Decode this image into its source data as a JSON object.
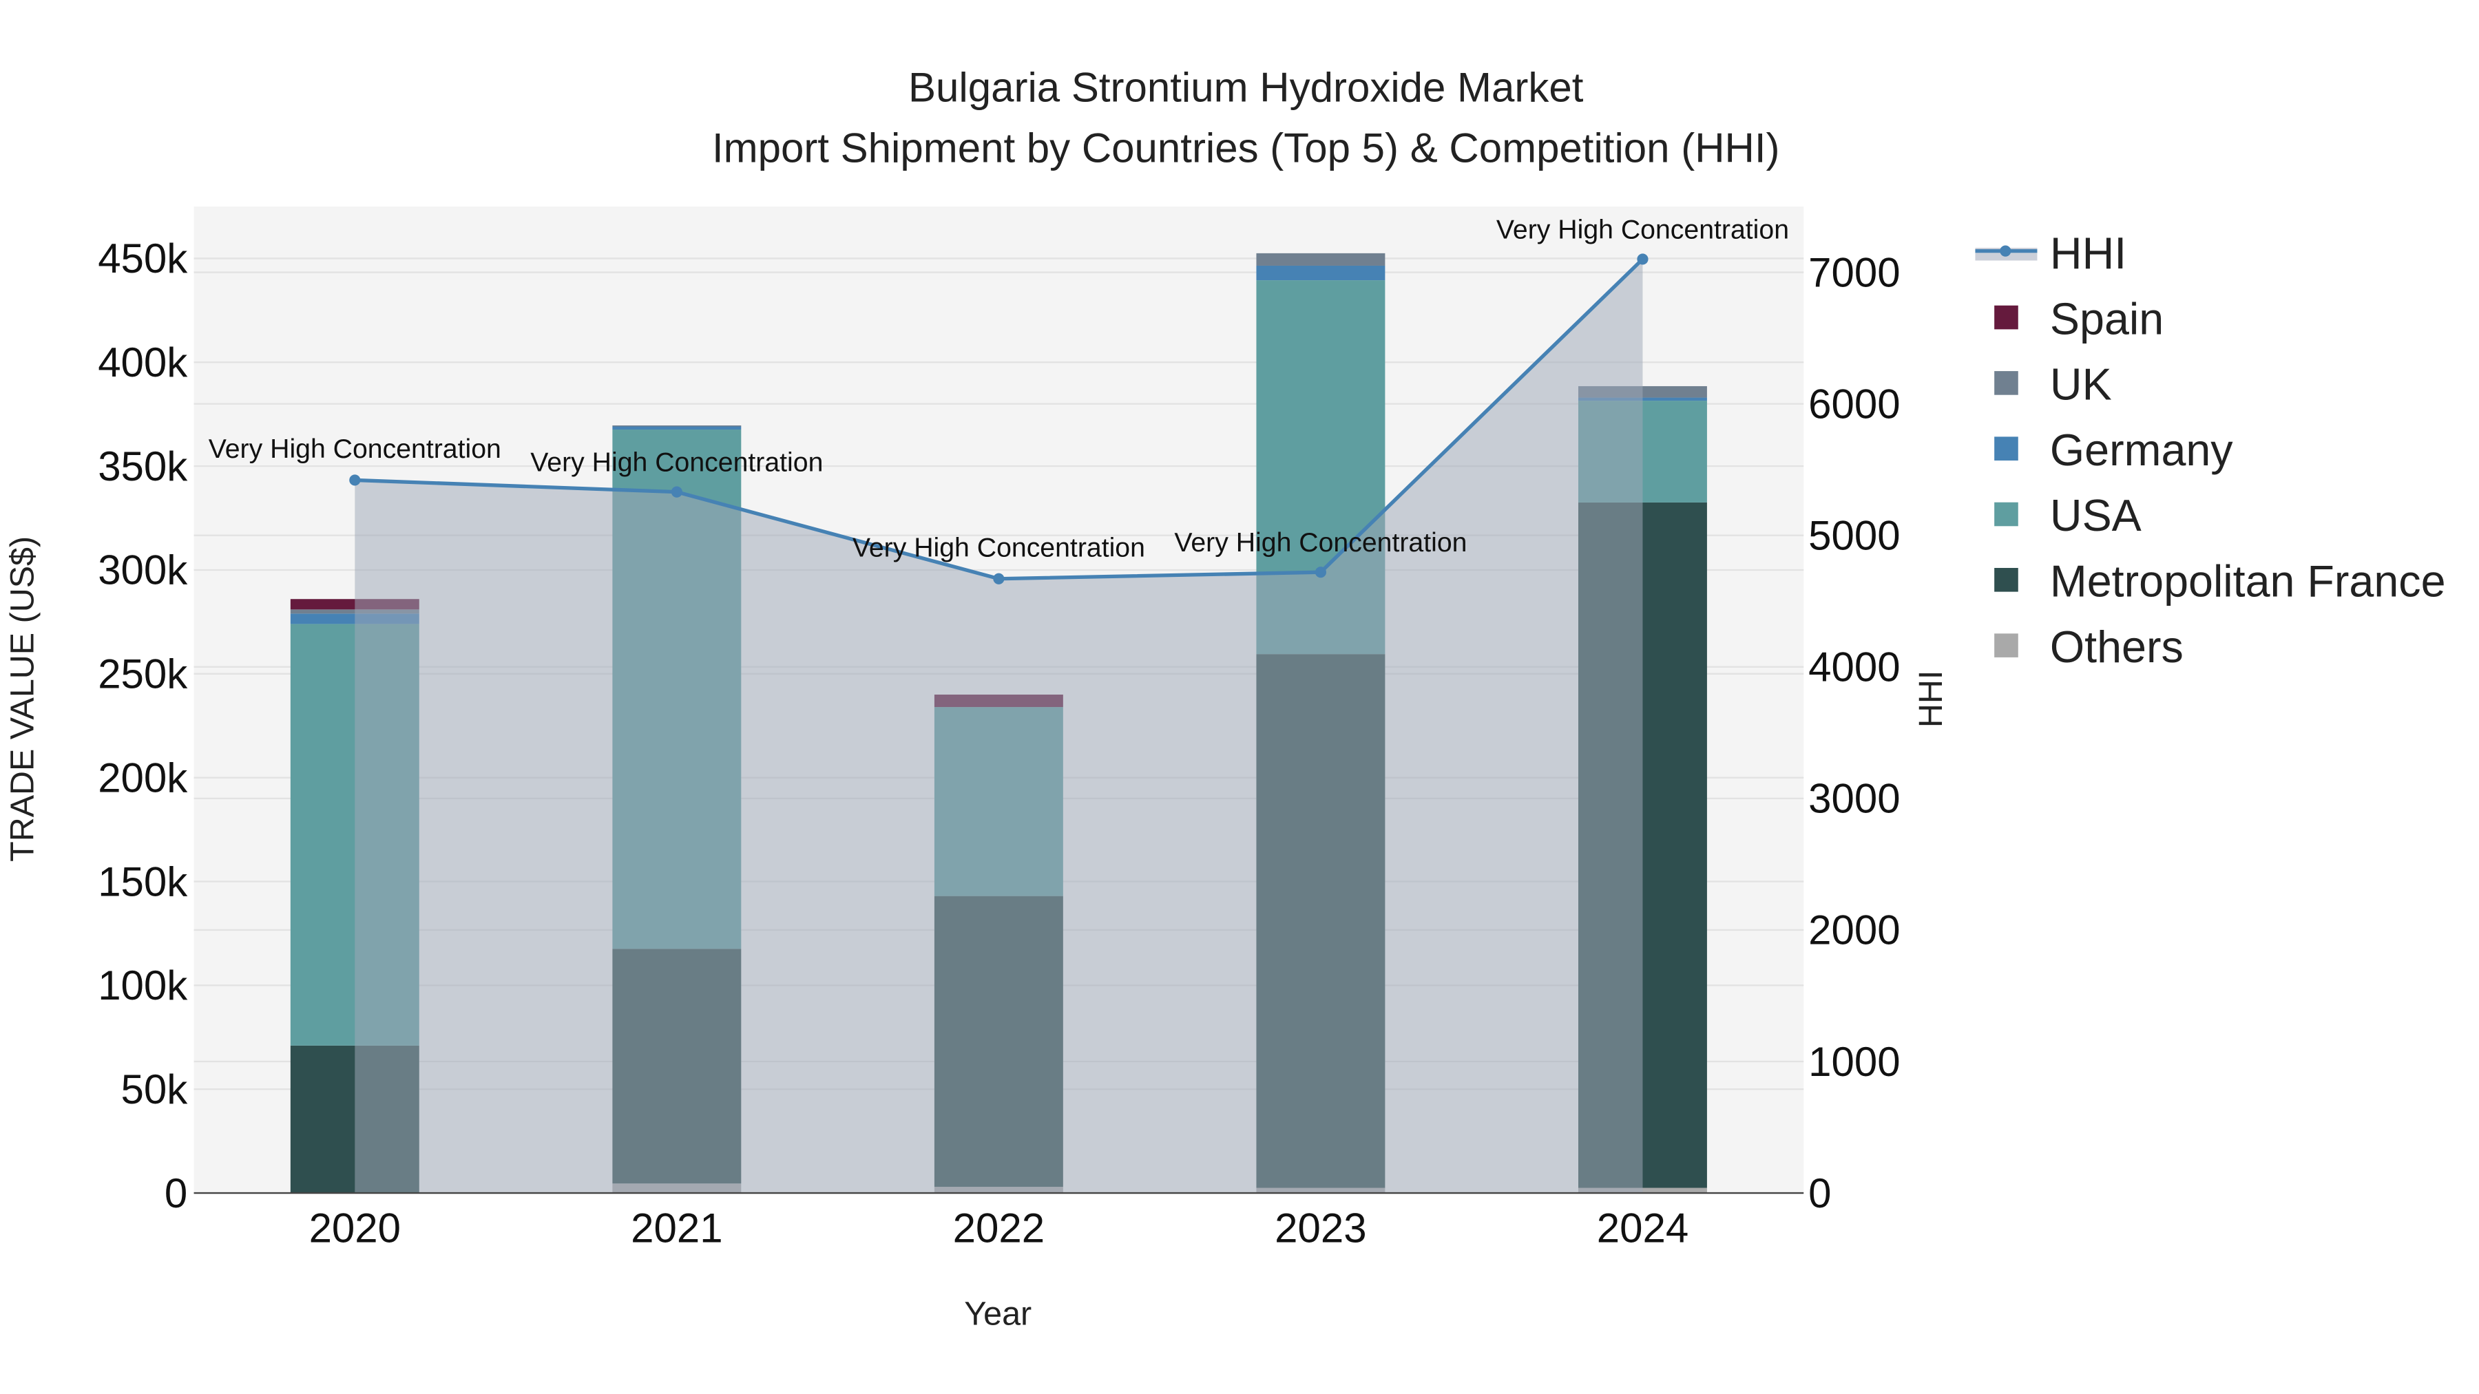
{
  "chart_data": {
    "type": "bar",
    "stacked": true,
    "title": "Bulgaria Strontium Hydroxide Market",
    "subtitle": "Import Shipment by Countries (Top 5) & Competition (HHI)",
    "xlabel": "Year",
    "ylabel": "TRADE VALUE (US$)",
    "y2label": "HHI",
    "categories": [
      "2020",
      "2021",
      "2022",
      "2023",
      "2024"
    ],
    "ylim": [
      0,
      475000
    ],
    "y2lim": [
      0,
      7500
    ],
    "yticks": [
      0,
      50000,
      100000,
      150000,
      200000,
      250000,
      300000,
      350000,
      400000,
      450000
    ],
    "ytick_labels": [
      "0",
      "50k",
      "100k",
      "150k",
      "200k",
      "250k",
      "300k",
      "350k",
      "400k",
      "450k"
    ],
    "y2ticks": [
      0,
      1000,
      2000,
      3000,
      4000,
      5000,
      6000,
      7000
    ],
    "y2tick_labels": [
      "0",
      "1000",
      "2000",
      "3000",
      "4000",
      "5000",
      "6000",
      "7000"
    ],
    "grid": true,
    "legend_position": "right",
    "series": [
      {
        "name": "Others",
        "color": "#a9a9a9",
        "values": [
          0,
          4600,
          3000,
          2500,
          2500
        ]
      },
      {
        "name": "Metropolitan France",
        "color": "#2f4f4f",
        "values": [
          71000,
          113000,
          140000,
          257000,
          330000
        ]
      },
      {
        "name": "USA",
        "color": "#5f9ea0",
        "values": [
          203000,
          250000,
          91000,
          180000,
          49000
        ]
      },
      {
        "name": "Germany",
        "color": "#4682b4",
        "values": [
          5000,
          1500,
          0,
          7000,
          1500
        ]
      },
      {
        "name": "UK",
        "color": "#708090",
        "values": [
          2000,
          500,
          0,
          6000,
          5500
        ]
      },
      {
        "name": "Spain",
        "color": "#651a3d",
        "values": [
          5000,
          0,
          6000,
          0,
          0
        ]
      }
    ],
    "hhi": {
      "name": "HHI",
      "color": "#4682b4",
      "values": [
        5420,
        5330,
        4670,
        4720,
        7100
      ],
      "annotations": [
        "Very High Concentration",
        "Very High Concentration",
        "Very High Concentration",
        "Very High Concentration",
        "Very High Concentration"
      ]
    },
    "legend": [
      "HHI",
      "Spain",
      "UK",
      "Germany",
      "USA",
      "Metropolitan France",
      "Others"
    ]
  }
}
